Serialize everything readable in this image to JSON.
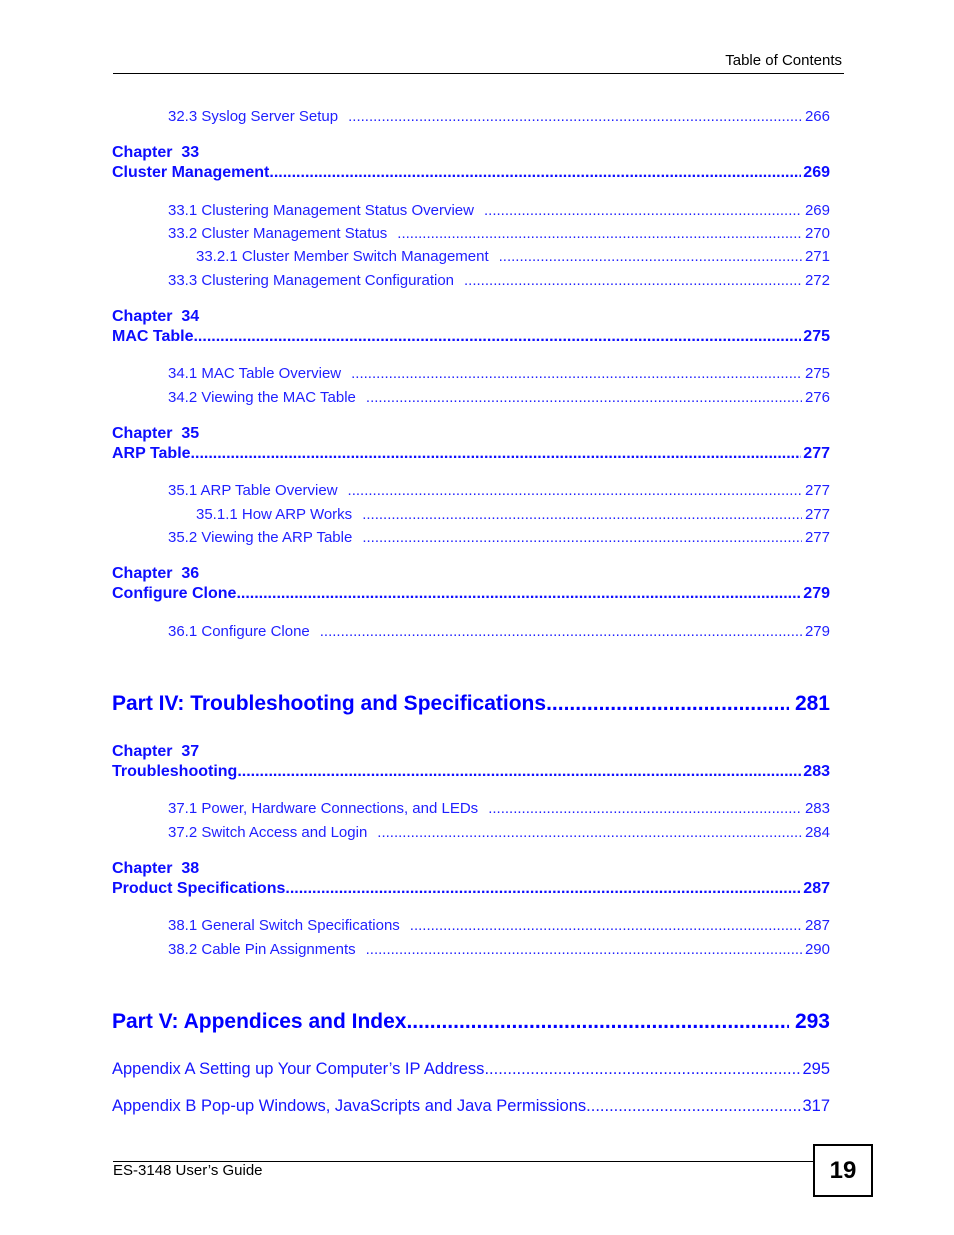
{
  "header": {
    "title": "Table of Contents"
  },
  "toc": {
    "s32_3": {
      "title": "32.3 Syslog Server Setup",
      "page": "266"
    },
    "ch33": {
      "label": "Chapter  33",
      "title": "Cluster Management",
      "page": "269",
      "sections": [
        {
          "title": "33.1 Clustering Management Status Overview",
          "page": "269"
        },
        {
          "title": "33.2 Cluster Management Status",
          "page": "270"
        },
        {
          "title": "33.2.1 Cluster Member Switch Management",
          "page": "271"
        },
        {
          "title": "33.3 Clustering Management Configuration",
          "page": "272"
        }
      ]
    },
    "ch34": {
      "label": "Chapter  34",
      "title": "MAC Table",
      "page": "275",
      "sections": [
        {
          "title": "34.1 MAC Table Overview",
          "page": "275"
        },
        {
          "title": "34.2 Viewing the MAC Table",
          "page": "276"
        }
      ]
    },
    "ch35": {
      "label": "Chapter  35",
      "title": "ARP Table ",
      "page": "277",
      "sections": [
        {
          "title": "35.1 ARP Table Overview",
          "page": "277"
        },
        {
          "title": "35.1.1 How ARP Works",
          "page": "277"
        },
        {
          "title": "35.2 Viewing the ARP Table",
          "page": "277"
        }
      ]
    },
    "ch36": {
      "label": "Chapter  36",
      "title": "Configure Clone ",
      "page": "279",
      "sections": [
        {
          "title": "36.1 Configure Clone",
          "page": "279"
        }
      ]
    },
    "part4": {
      "title": "Part IV: Troubleshooting and Specifications",
      "page": "281"
    },
    "ch37": {
      "label": "Chapter  37",
      "title": "Troubleshooting",
      "page": "283",
      "sections": [
        {
          "title": "37.1 Power, Hardware Connections, and LEDs",
          "page": "283"
        },
        {
          "title": "37.2 Switch Access and Login",
          "page": "284"
        }
      ]
    },
    "ch38": {
      "label": "Chapter  38",
      "title": "Product Specifications ",
      "page": "287",
      "sections": [
        {
          "title": "38.1 General Switch Specifications",
          "page": "287"
        },
        {
          "title": "38.2 Cable Pin Assignments",
          "page": "290"
        }
      ]
    },
    "part5": {
      "title": "Part V: Appendices and Index ",
      "page": "293"
    },
    "appendices": [
      {
        "title": "Appendix   A  Setting up Your Computer’s IP Address",
        "page": "295"
      },
      {
        "title": "Appendix   B  Pop-up Windows, JavaScripts and Java Permissions ",
        "page": "317"
      }
    ]
  },
  "footer": {
    "guide": "ES-3148 User’s Guide",
    "page_number": "19"
  }
}
